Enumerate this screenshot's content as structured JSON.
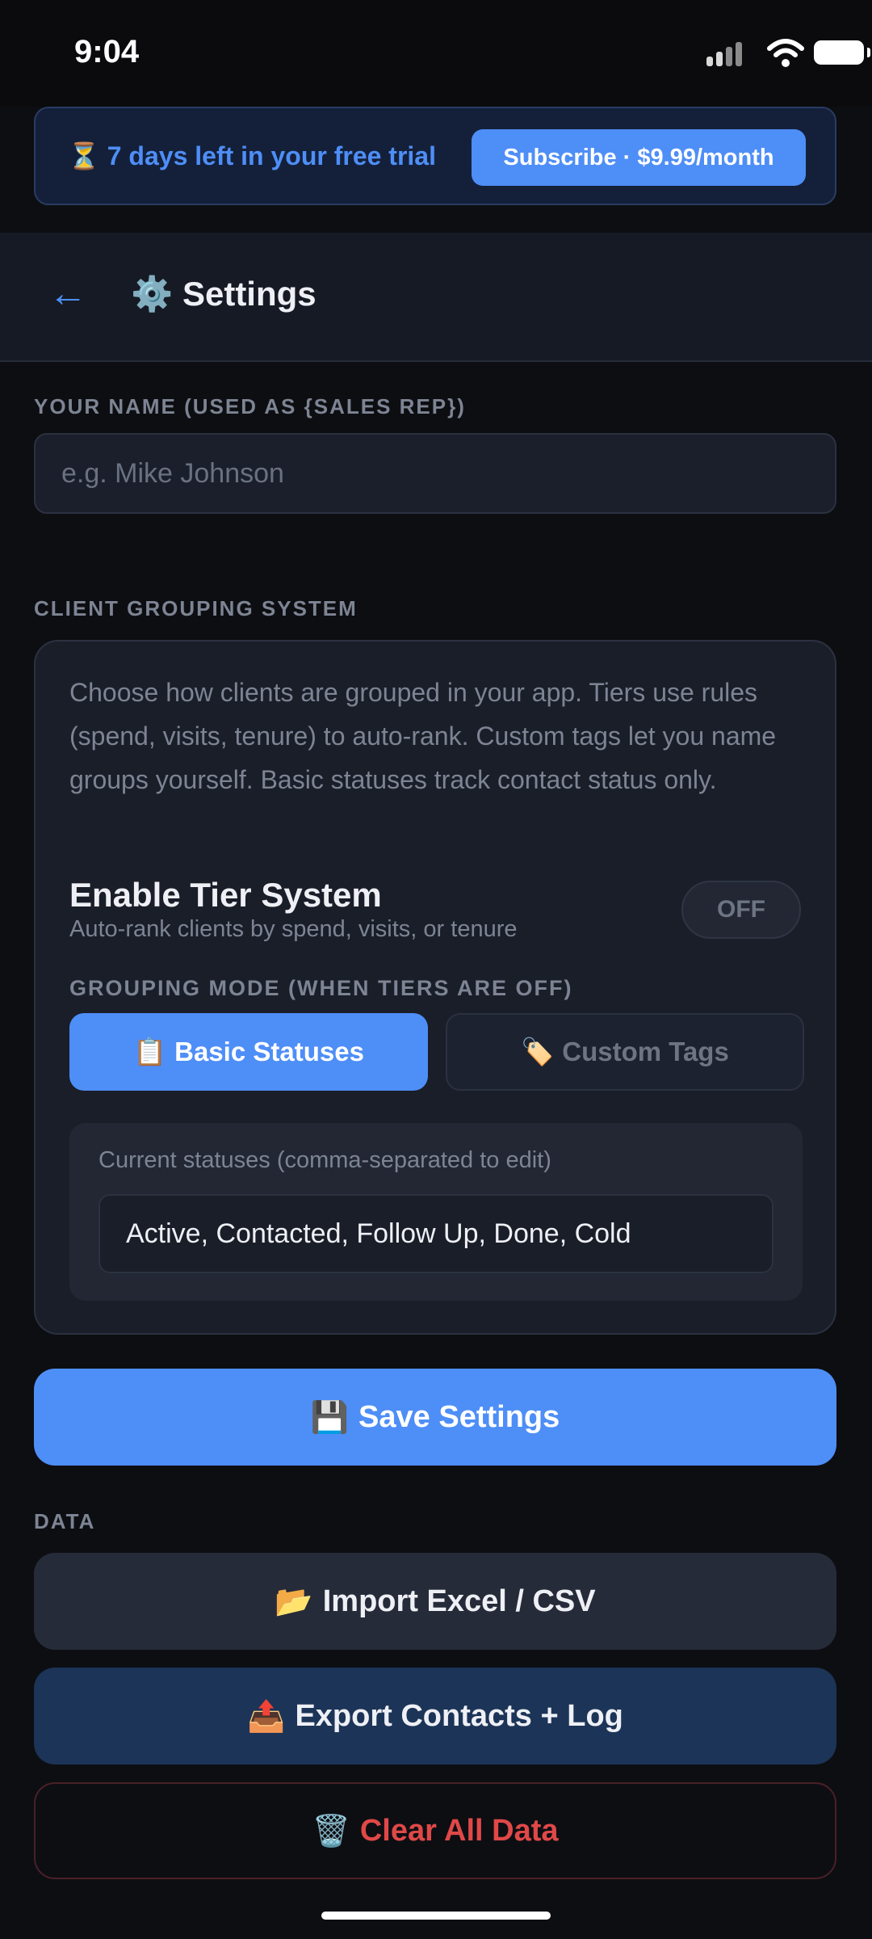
{
  "status_bar": {
    "time": "9:04"
  },
  "trial_banner": {
    "text": "⏳ 7 days left in your free trial",
    "subscribe_label": "Subscribe · $9.99/month"
  },
  "header": {
    "back_icon": "←",
    "title": "⚙️ Settings"
  },
  "name_section": {
    "label": "YOUR NAME (USED AS {SALES REP})",
    "placeholder": "e.g. Mike Johnson",
    "value": ""
  },
  "grouping": {
    "section_label": "CLIENT GROUPING SYSTEM",
    "description": "Choose how clients are grouped in your app. Tiers use rules (spend, visits, tenure) to auto-rank. Custom tags let you name groups yourself. Basic statuses track contact status only.",
    "tier_title": "Enable Tier System",
    "tier_subtitle": "Auto-rank clients by spend, visits, or tenure",
    "tier_toggle": "OFF",
    "mode_label": "GROUPING MODE (WHEN TIERS ARE OFF)",
    "modes": [
      {
        "icon": "📋",
        "label": "Basic Statuses",
        "selected": true
      },
      {
        "icon": "🏷️",
        "label": "Custom Tags",
        "selected": false
      }
    ],
    "statuses_label": "Current statuses (comma-separated to edit)",
    "statuses_value": "Active, Contacted, Follow Up, Done, Cold"
  },
  "save_button": {
    "icon": "💾",
    "label": "Save Settings"
  },
  "data_section": {
    "label": "DATA",
    "import": {
      "icon": "📂",
      "label": "Import Excel / CSV"
    },
    "export": {
      "icon": "📤",
      "label": "Export Contacts + Log"
    },
    "clear": {
      "icon": "🗑️",
      "label": "Clear All Data"
    }
  },
  "colors": {
    "accent": "#4e8ef7",
    "danger": "#e04848",
    "background": "#0d0e12"
  }
}
